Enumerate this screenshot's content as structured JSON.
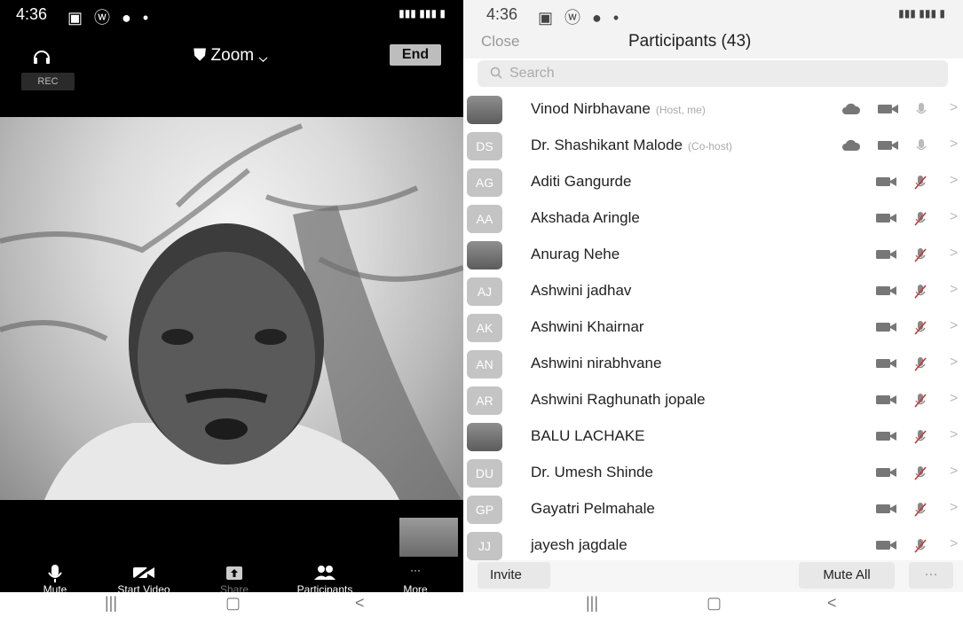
{
  "left": {
    "status": {
      "time": "4:36",
      "icons": "▣ ⓦ ●  •"
    },
    "header": {
      "meeting_title": "Zoom",
      "end_label": "End",
      "rec_label": "REC"
    },
    "toolbar": [
      {
        "name": "mute",
        "label": "Mute",
        "icon": "mic-icon"
      },
      {
        "name": "start-video",
        "label": "Start Video",
        "icon": "video-off-icon"
      },
      {
        "name": "share",
        "label": "Share",
        "icon": "share-icon"
      },
      {
        "name": "participants",
        "label": "Participants",
        "icon": "people-icon"
      },
      {
        "name": "more",
        "label": "More",
        "icon": "more-icon"
      }
    ],
    "navbar": [
      "|||",
      "▢",
      "<"
    ]
  },
  "right": {
    "status": {
      "time": "4:36",
      "icons": "▣ ⓦ ●  •"
    },
    "header": {
      "close_label": "Close",
      "title": "Participants (43)"
    },
    "search": {
      "placeholder": "Search"
    },
    "participants": [
      {
        "initials": "",
        "photo": true,
        "name": "Vinod Nirbhavane",
        "role": "(Host, me)",
        "icons": [
          "cloud",
          "video",
          "mic"
        ]
      },
      {
        "initials": "DS",
        "photo": false,
        "name": "Dr. Shashikant Malode",
        "role": "(Co-host)",
        "icons": [
          "cloud",
          "video",
          "mic"
        ]
      },
      {
        "initials": "AG",
        "photo": false,
        "name": "Aditi Gangurde",
        "role": "",
        "icons": [
          "video",
          "mic-off"
        ]
      },
      {
        "initials": "AA",
        "photo": false,
        "name": "Akshada Aringle",
        "role": "",
        "icons": [
          "video",
          "mic-off"
        ]
      },
      {
        "initials": "",
        "photo": true,
        "name": "Anurag Nehe",
        "role": "",
        "icons": [
          "video",
          "mic-off"
        ]
      },
      {
        "initials": "AJ",
        "photo": false,
        "name": "Ashwini jadhav",
        "role": "",
        "icons": [
          "video",
          "mic-off"
        ]
      },
      {
        "initials": "AK",
        "photo": false,
        "name": "Ashwini Khairnar",
        "role": "",
        "icons": [
          "video",
          "mic-off"
        ]
      },
      {
        "initials": "AN",
        "photo": false,
        "name": "Ashwini nirabhvane",
        "role": "",
        "icons": [
          "video",
          "mic-off"
        ]
      },
      {
        "initials": "AR",
        "photo": false,
        "name": "Ashwini Raghunath jopale",
        "role": "",
        "icons": [
          "video",
          "mic-off"
        ]
      },
      {
        "initials": "",
        "photo": true,
        "name": "BALU LACHAKE",
        "role": "",
        "icons": [
          "video",
          "mic-off"
        ]
      },
      {
        "initials": "DU",
        "photo": false,
        "name": "Dr. Umesh Shinde",
        "role": "",
        "icons": [
          "video",
          "mic-off"
        ]
      },
      {
        "initials": "GP",
        "photo": false,
        "name": "Gayatri Pelmahale",
        "role": "",
        "icons": [
          "video",
          "mic-off"
        ]
      },
      {
        "initials": "JJ",
        "photo": false,
        "name": "jayesh jagdale",
        "role": "",
        "icons": [
          "video",
          "mic-off"
        ]
      }
    ],
    "footer": {
      "invite_label": "Invite",
      "mute_all_label": "Mute All",
      "more_label": "···"
    },
    "navbar": [
      "|||",
      "▢",
      "<"
    ]
  }
}
